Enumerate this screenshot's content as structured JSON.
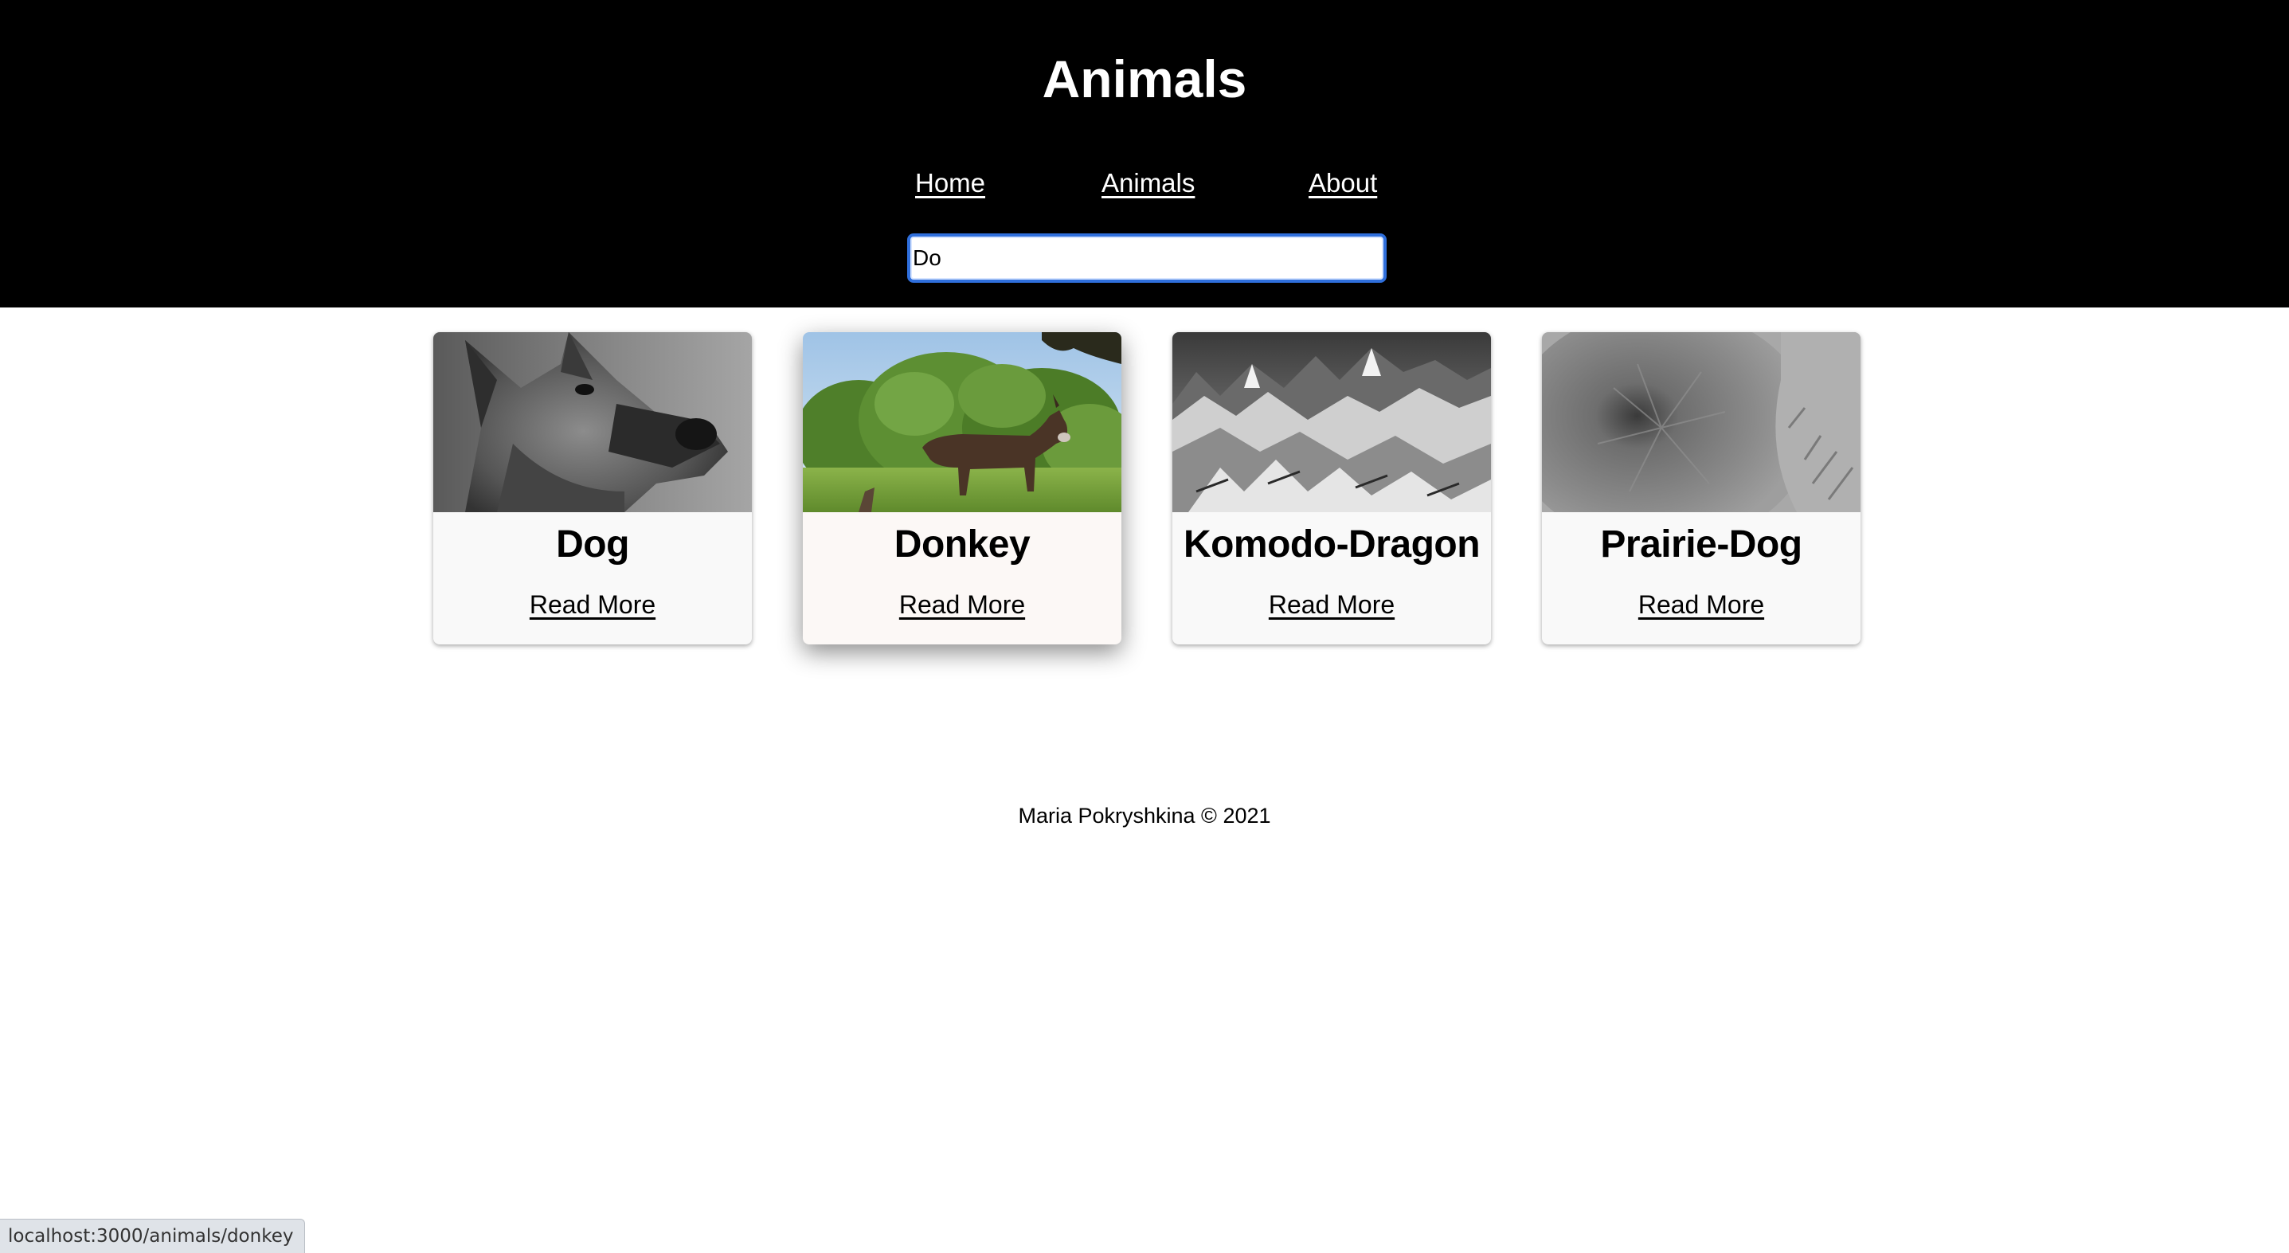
{
  "site": {
    "title": "Animals"
  },
  "nav": {
    "items": [
      {
        "label": "Home"
      },
      {
        "label": "Animals"
      },
      {
        "label": "About"
      }
    ]
  },
  "search": {
    "value": "Do"
  },
  "cards": [
    {
      "title": "Dog",
      "link_label": "Read More",
      "image": "dog-photo"
    },
    {
      "title": "Donkey",
      "link_label": "Read More",
      "image": "donkey-photo",
      "hovered": true
    },
    {
      "title": "Komodo-Dragon",
      "link_label": "Read More",
      "image": "mountain-photo"
    },
    {
      "title": "Prairie-Dog",
      "link_label": "Read More",
      "image": "furry-animal-photo"
    }
  ],
  "footer": {
    "text": "Maria Pokryshkina © 2021"
  },
  "status_bar": {
    "url": "localhost:3000/animals/donkey"
  },
  "colors": {
    "header_bg": "#000000",
    "focus_ring": "#2f6fdc",
    "card_bg": "#f9f9f9"
  }
}
